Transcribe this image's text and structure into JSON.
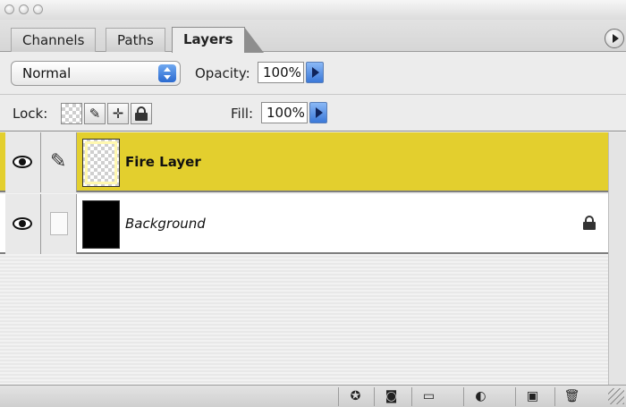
{
  "window": {
    "title_buttons": [
      "close",
      "minimize",
      "zoom"
    ]
  },
  "tabs": [
    {
      "label": "Channels",
      "active": false
    },
    {
      "label": "Paths",
      "active": false
    },
    {
      "label": "Layers",
      "active": true
    }
  ],
  "options": {
    "blend_mode": "Normal",
    "opacity_label": "Opacity:",
    "opacity_value": "100%",
    "lock_label": "Lock:",
    "fill_label": "Fill:",
    "fill_value": "100%"
  },
  "layers": [
    {
      "name": "Fire Layer",
      "selected": true,
      "visible": true,
      "thumbnail": "transparent",
      "locked": false
    },
    {
      "name": "Background",
      "selected": false,
      "visible": true,
      "thumbnail": "black",
      "locked": true
    }
  ],
  "colors": {
    "selected_layer": "#e3cf2e",
    "accent_blue": "#3a78d8"
  },
  "bottom_buttons": [
    "add-layer-style-icon",
    "add-mask-icon",
    "new-group-icon",
    "adjustment-layer-icon",
    "new-layer-icon",
    "trash-icon"
  ]
}
